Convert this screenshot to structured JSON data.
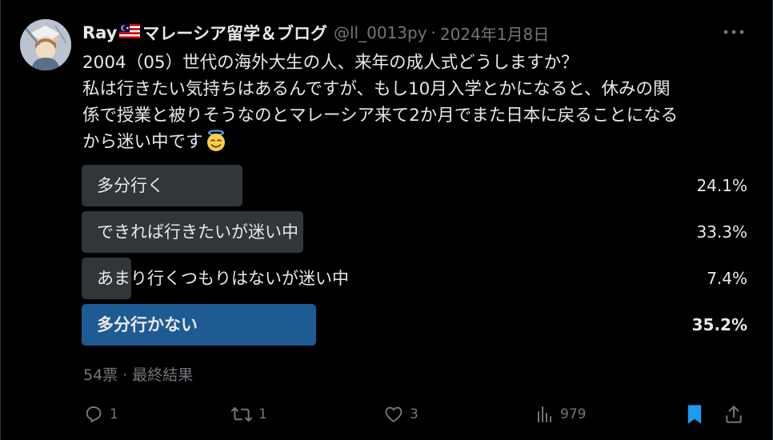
{
  "tweet": {
    "author": {
      "display_name": "Ray",
      "display_name_suffix": "マレーシア留学＆ブログ",
      "flag_icon": "malaysia-flag-icon",
      "handle": "@ll_0013py",
      "separator": "·",
      "date": "2024年1月8日"
    },
    "text_lines": [
      "2004（05）世代の海外大生の人、来年の成人式どうしますか？",
      "私は行きたい気持ちはあるんですが、もし10月入学とかになると、休みの関",
      "係で授業と被りそうなのとマレーシア来て2か月でまた日本に戻ることになる",
      "から迷い中です"
    ],
    "emoji": "smiling-face-with-halo-icon",
    "poll": {
      "options": [
        {
          "label": "多分行く",
          "percent_text": "24.1%",
          "percent": 24.1,
          "winner": false
        },
        {
          "label": "できれば行きたいが迷い中",
          "percent_text": "33.3%",
          "percent": 33.3,
          "winner": false
        },
        {
          "label": "あまり行くつもりはないが迷い中",
          "percent_text": "7.4%",
          "percent": 7.4,
          "winner": false
        },
        {
          "label": "多分行かない",
          "percent_text": "35.2%",
          "percent": 35.2,
          "winner": true
        }
      ],
      "footer": "54票 · 最終結果"
    },
    "actions": {
      "replies": "1",
      "retweets": "1",
      "likes": "3",
      "views": "979"
    }
  },
  "colors": {
    "background": "#000000",
    "text": "#e7e9ea",
    "muted": "#71767b",
    "poll_bar": "#333639",
    "poll_winner": "#1e5a93",
    "bookmark": "#1d9bf0"
  }
}
